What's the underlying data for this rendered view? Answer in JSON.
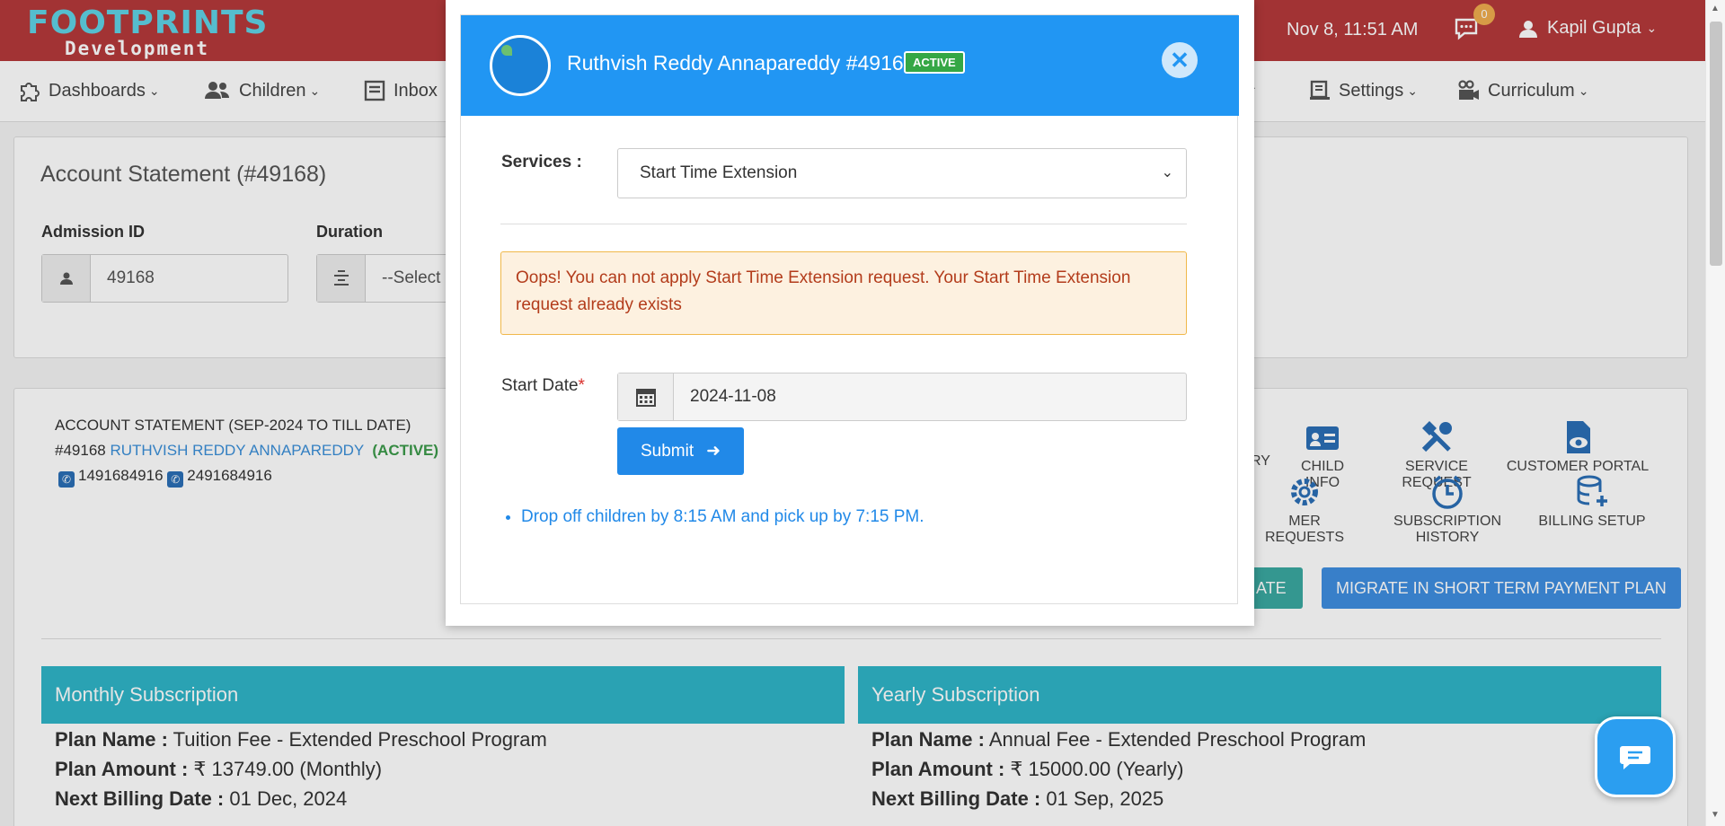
{
  "header": {
    "logo_main": "FOOTPRINTS",
    "logo_sub": "Development",
    "datetime": "Nov 8, 11:51 AM",
    "notification_count": "0",
    "user_name": "Kapil Gupta"
  },
  "nav": {
    "items": [
      {
        "label": "Dashboards",
        "icon": "puzzle-icon"
      },
      {
        "label": "Children",
        "icon": "users-icon"
      },
      {
        "label": "Inbox",
        "icon": "inbox-icon"
      },
      {
        "label": "Settings",
        "icon": "settings-icon"
      },
      {
        "label": "Curriculum",
        "icon": "curriculum-icon"
      }
    ]
  },
  "statement": {
    "title": "Account Statement (#49168)",
    "admission_label": "Admission ID",
    "admission_value": "49168",
    "duration_label": "Duration",
    "duration_value": "--Select",
    "heading": "ACCOUNT STATEMENT (SEP-2024 TO TILL DATE)",
    "child_id": "#49168",
    "child_name": "RUTHVISH REDDY ANNAPAREDDY",
    "child_status": "(ACTIVE)",
    "phone1": "1491684916",
    "phone2": "2491684916",
    "actions": [
      {
        "label": "RY",
        "icon": "history-icon"
      },
      {
        "label": "CHILD INFO",
        "icon": "id-card-icon"
      },
      {
        "label": "SERVICE REQUEST",
        "icon": "tools-icon"
      },
      {
        "label": "CUSTOMER PORTAL",
        "icon": "eye-document-icon"
      },
      {
        "label": "MER REQUESTS",
        "icon": "gear-icon"
      },
      {
        "label": "SUBSCRIPTION HISTORY",
        "icon": "clock-icon"
      },
      {
        "label": "BILLING SETUP",
        "icon": "database-plus-icon"
      }
    ],
    "btn_partial": "ATE",
    "btn_migrate": "MIGRATE IN SHORT TERM PAYMENT PLAN",
    "monthly": {
      "heading": "Monthly Subscription",
      "plan_name_label": "Plan Name :",
      "plan_name": "Tuition Fee - Extended Preschool Program",
      "plan_amount_label": "Plan Amount :",
      "plan_amount": "₹ 13749.00 (Monthly)",
      "next_billing_label": "Next Billing Date :",
      "next_billing": "01 Dec, 2024"
    },
    "yearly": {
      "heading": "Yearly Subscription",
      "plan_name_label": "Plan Name :",
      "plan_name": "Annual Fee - Extended Preschool Program",
      "plan_amount_label": "Plan Amount :",
      "plan_amount": "₹ 15000.00 (Yearly)",
      "next_billing_label": "Next Billing Date :",
      "next_billing": "01 Sep, 2025"
    }
  },
  "modal": {
    "title": "Ruthvish Reddy Annapareddy #49168",
    "badge": "ACTIVE",
    "services_label": "Services :",
    "services_value": "Start Time Extension",
    "alert": "Oops! You can not apply Start Time Extension request. Your Start Time Extension request already exists",
    "start_date_label": "Start Date",
    "required_mark": "*",
    "start_date_value": "2024-11-08",
    "submit_label": "Submit",
    "info_items": [
      "Drop off children by 8:15 AM and pick up by 7:15 PM."
    ]
  },
  "colors": {
    "header_bg": "#b5393a",
    "modal_header": "#2196f3",
    "teal": "#2fb5c8",
    "alert_bg": "#fdf1e0"
  }
}
